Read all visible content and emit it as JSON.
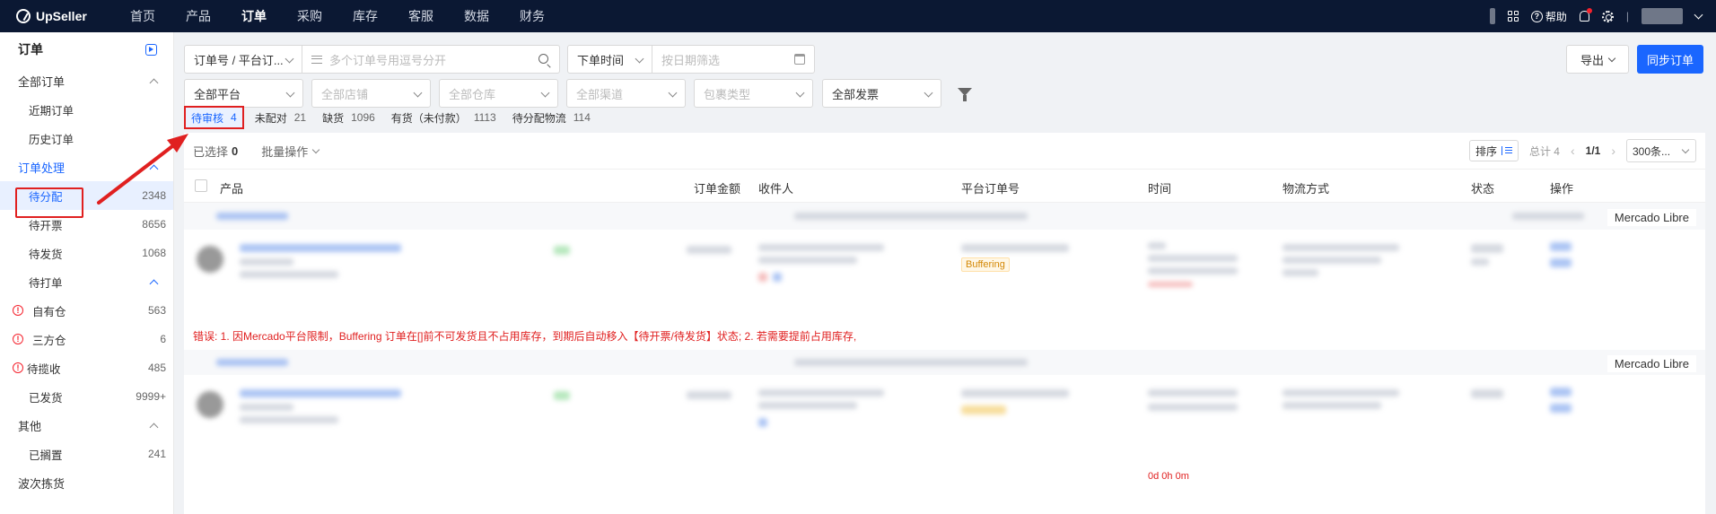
{
  "app": {
    "logo_text": "UpSeller",
    "nav": [
      "首页",
      "产品",
      "订单",
      "采购",
      "库存",
      "客服",
      "数据",
      "财务"
    ],
    "active_nav": "订单",
    "help_label": "帮助"
  },
  "sidebar": {
    "title": "订单",
    "sections": [
      {
        "label": "全部订单",
        "active": false,
        "items": [
          {
            "label": "近期订单",
            "count": ""
          },
          {
            "label": "历史订单",
            "count": ""
          }
        ]
      },
      {
        "label": "订单处理",
        "active": true,
        "items": [
          {
            "label": "待分配",
            "count": "2348",
            "selected": true
          },
          {
            "label": "待开票",
            "count": "8656"
          },
          {
            "label": "待发货",
            "count": "1068"
          }
        ]
      },
      {
        "label": "待打单",
        "active": false,
        "items": [
          {
            "label": "自有仓",
            "count": "563",
            "warn": true
          },
          {
            "label": "三方仓",
            "count": "6",
            "warn": true
          },
          {
            "label": "待揽收",
            "count": "485",
            "warn": true,
            "nosub": true
          },
          {
            "label": "已发货",
            "count": "9999+"
          }
        ]
      },
      {
        "label": "其他",
        "active": false,
        "items": [
          {
            "label": "已搁置",
            "count": "241"
          }
        ]
      }
    ],
    "standalone": "波次拣货"
  },
  "filters": {
    "order_type": "订单号 / 平台订...",
    "search_placeholder": "多个订单号用逗号分开",
    "date_type": "下单时间",
    "date_placeholder": "按日期筛选",
    "platform": "全部平台",
    "store": "全部店铺",
    "warehouse": "全部仓库",
    "channel": "全部渠道",
    "package_type": "包裹类型",
    "invoice": "全部发票",
    "export_label": "导出",
    "sync_label": "同步订单"
  },
  "tabs": [
    {
      "label": "待审核",
      "count": "4",
      "active": true
    },
    {
      "label": "未配对",
      "count": "21"
    },
    {
      "label": "缺货",
      "count": "1096"
    },
    {
      "label": "有货（未付款）",
      "count": "1113"
    },
    {
      "label": "待分配物流",
      "count": "114"
    }
  ],
  "toolbar": {
    "selected_label": "已选择",
    "selected_count": "0",
    "batch_label": "批量操作",
    "sort_label": "排序",
    "total_label": "总计 4",
    "page": "1/1",
    "page_size": "300条..."
  },
  "table": {
    "columns": [
      "产品",
      "订单金额",
      "收件人",
      "平台订单号",
      "时间",
      "物流方式",
      "状态",
      "操作"
    ],
    "orders": [
      {
        "platform": "Mercado Libre",
        "tag": "Buffering"
      },
      {
        "platform": "Mercado Libre",
        "timer": "0d 0h 0m"
      }
    ],
    "error_text": "错误: 1. 因Mercado平台限制，Buffering 订单在[]前不可发货且不占用库存，到期后自动移入【待开票/待发货】状态; 2. 若需要提前占用库存,"
  },
  "colors": {
    "nav_bg": "#0b1833",
    "accent": "#1a66ff",
    "annotation": "#e02020"
  }
}
